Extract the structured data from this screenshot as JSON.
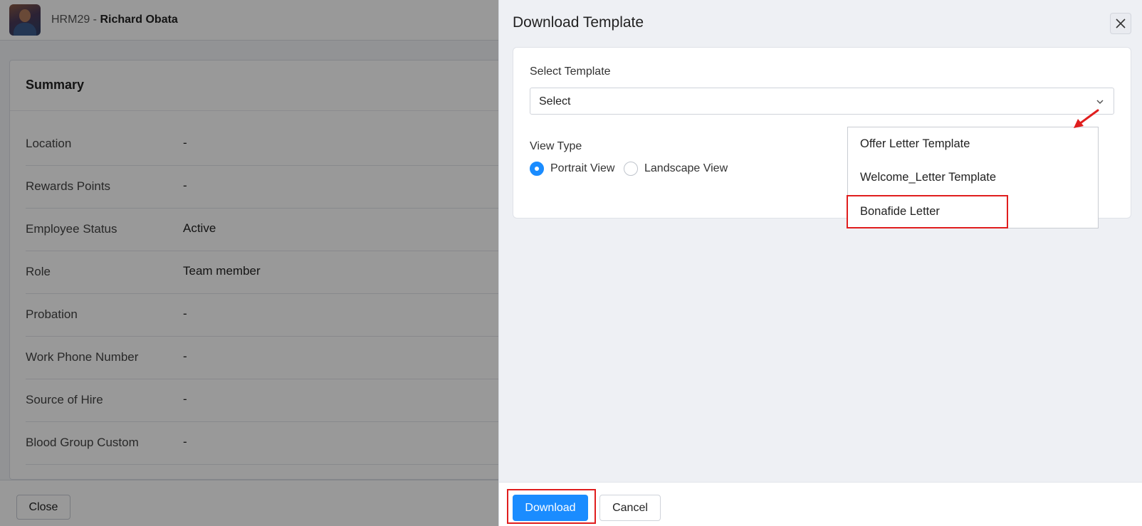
{
  "employee": {
    "id": "HRM29",
    "separator": " - ",
    "name": "Richard Obata"
  },
  "summary": {
    "title": "Summary",
    "rows": [
      {
        "label": "Location",
        "value": "-"
      },
      {
        "label": "Rewards Points",
        "value": "-"
      },
      {
        "label": "Employee Status",
        "value": "Active"
      },
      {
        "label": "Role",
        "value": "Team member"
      },
      {
        "label": "Probation",
        "value": "-"
      },
      {
        "label": "Work Phone Number",
        "value": "-"
      },
      {
        "label": "Source of Hire",
        "value": "-"
      },
      {
        "label": "Blood Group Custom",
        "value": "-"
      }
    ],
    "close_label": "Close"
  },
  "modal": {
    "title": "Download Template",
    "close_icon": "close-icon",
    "select_template_label": "Select Template",
    "select_value": "Select",
    "view_type_label": "View Type",
    "view_options": [
      {
        "label": "Portrait View",
        "selected": true
      },
      {
        "label": "Landscape View",
        "selected": false
      }
    ],
    "dropdown_options": [
      "Offer Letter Template",
      "Welcome_Letter Template",
      "Bonafide Letter"
    ],
    "download_label": "Download",
    "cancel_label": "Cancel"
  },
  "colors": {
    "primary": "#1a8cff",
    "highlight": "#e01e1e",
    "panel_bg": "#eef0f4"
  }
}
